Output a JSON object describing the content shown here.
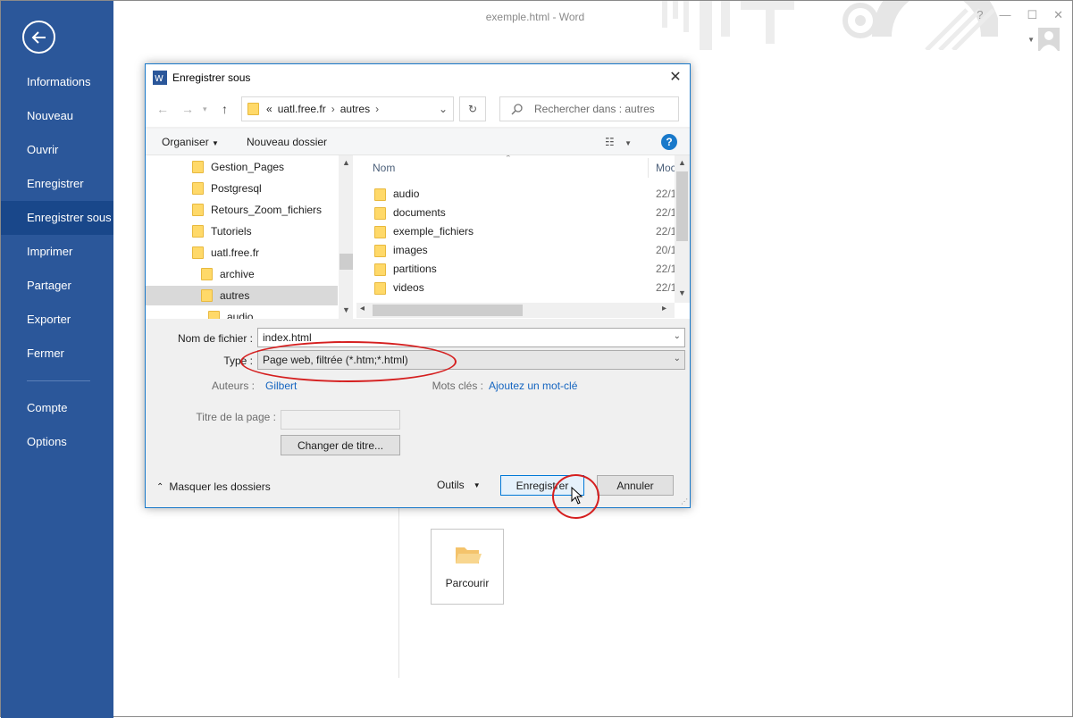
{
  "window": {
    "title": "exemple.html - Word",
    "controls": [
      "?",
      "—",
      "☐",
      "✕"
    ]
  },
  "backstage": {
    "items": [
      {
        "label": "Informations"
      },
      {
        "label": "Nouveau"
      },
      {
        "label": "Ouvrir"
      },
      {
        "label": "Enregistrer"
      },
      {
        "label": "Enregistrer sous",
        "active": true
      },
      {
        "label": "Imprimer"
      },
      {
        "label": "Partager"
      },
      {
        "label": "Exporter"
      },
      {
        "label": "Fermer"
      },
      {
        "label": "Compte"
      },
      {
        "label": "Options"
      }
    ],
    "browse_label": "Parcourir"
  },
  "dialog": {
    "title": "Enregistrer sous",
    "address": {
      "prefix": "«",
      "crumbs": [
        "uatl.free.fr",
        "autres"
      ]
    },
    "search_placeholder": "Rechercher dans : autres",
    "toolbar": {
      "organize": "Organiser",
      "new_folder": "Nouveau dossier",
      "help": "?"
    },
    "tree": [
      {
        "label": "Gestion_Pages",
        "indent": 0
      },
      {
        "label": "Postgresql",
        "indent": 0
      },
      {
        "label": "Retours_Zoom_fichiers",
        "indent": 0
      },
      {
        "label": "Tutoriels",
        "indent": 0
      },
      {
        "label": "uatl.free.fr",
        "indent": 0
      },
      {
        "label": "archive",
        "indent": 1
      },
      {
        "label": "autres",
        "indent": 1,
        "selected": true
      },
      {
        "label": "audio",
        "indent": 2
      }
    ],
    "columns": {
      "name": "Nom",
      "modified": "Moc"
    },
    "files": [
      {
        "name": "audio",
        "date": "22/1"
      },
      {
        "name": "documents",
        "date": "22/1"
      },
      {
        "name": "exemple_fichiers",
        "date": "22/1"
      },
      {
        "name": "images",
        "date": "20/1"
      },
      {
        "name": "partitions",
        "date": "22/1"
      },
      {
        "name": "videos",
        "date": "22/1"
      }
    ],
    "form": {
      "filename_label": "Nom de fichier :",
      "filename_value": "index.html",
      "type_label": "Type :",
      "type_value": "Page web, filtrée (*.htm;*.html)",
      "authors_label": "Auteurs :",
      "authors_value": "Gilbert",
      "keywords_label": "Mots clés :",
      "keywords_value": "Ajoutez un mot-clé",
      "page_title_label": "Titre de la page :",
      "change_title_button": "Changer de titre..."
    },
    "footer": {
      "hide_folders": "Masquer les dossiers",
      "tools": "Outils",
      "save": "Enregistrer",
      "cancel": "Annuler"
    }
  },
  "colors": {
    "backstage": "#2b579a",
    "backstage_active": "#19478a",
    "accent": "#1979ca",
    "annotation": "#d51f1f"
  }
}
